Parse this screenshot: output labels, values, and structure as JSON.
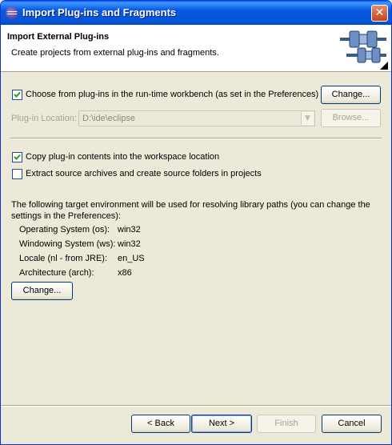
{
  "window": {
    "title": "Import Plug-ins and Fragments",
    "close_glyph": "✕"
  },
  "banner": {
    "title": "Import External Plug-ins",
    "description": "Create projects from external plug-ins and fragments.",
    "graphic_icon": "plugin-import-wizard-icon"
  },
  "runtime": {
    "checkbox_checked": true,
    "checkbox_label": "Choose from plug-ins in the run-time workbench (as set in the Preferences)",
    "change_button": "Change...",
    "location_label": "Plug-in Location:",
    "location_value": "D:\\ide\\eclipse",
    "browse_button": "Browse..."
  },
  "options": {
    "copy_checked": true,
    "copy_label": "Copy plug-in contents into the workspace location",
    "extract_checked": false,
    "extract_label": "Extract source archives and create source folders in projects"
  },
  "environment": {
    "description": "The following target environment will be used for resolving library paths (you can change the settings in the Preferences):",
    "rows": [
      {
        "label": "Operating System (os):",
        "value": "win32"
      },
      {
        "label": "Windowing System (ws):",
        "value": "win32"
      },
      {
        "label": "Locale (nl - from JRE):",
        "value": "en_US"
      },
      {
        "label": "Architecture (arch):",
        "value": "x86"
      }
    ],
    "change_button": "Change..."
  },
  "footer": {
    "back_button": "< Back",
    "next_button": "Next >",
    "finish_button": "Finish",
    "cancel_button": "Cancel"
  },
  "colors": {
    "titlebar": "#0555d6",
    "dialog_bg": "#ece9d8",
    "banner_bg": "#ffffff",
    "button_border": "#003c74"
  }
}
